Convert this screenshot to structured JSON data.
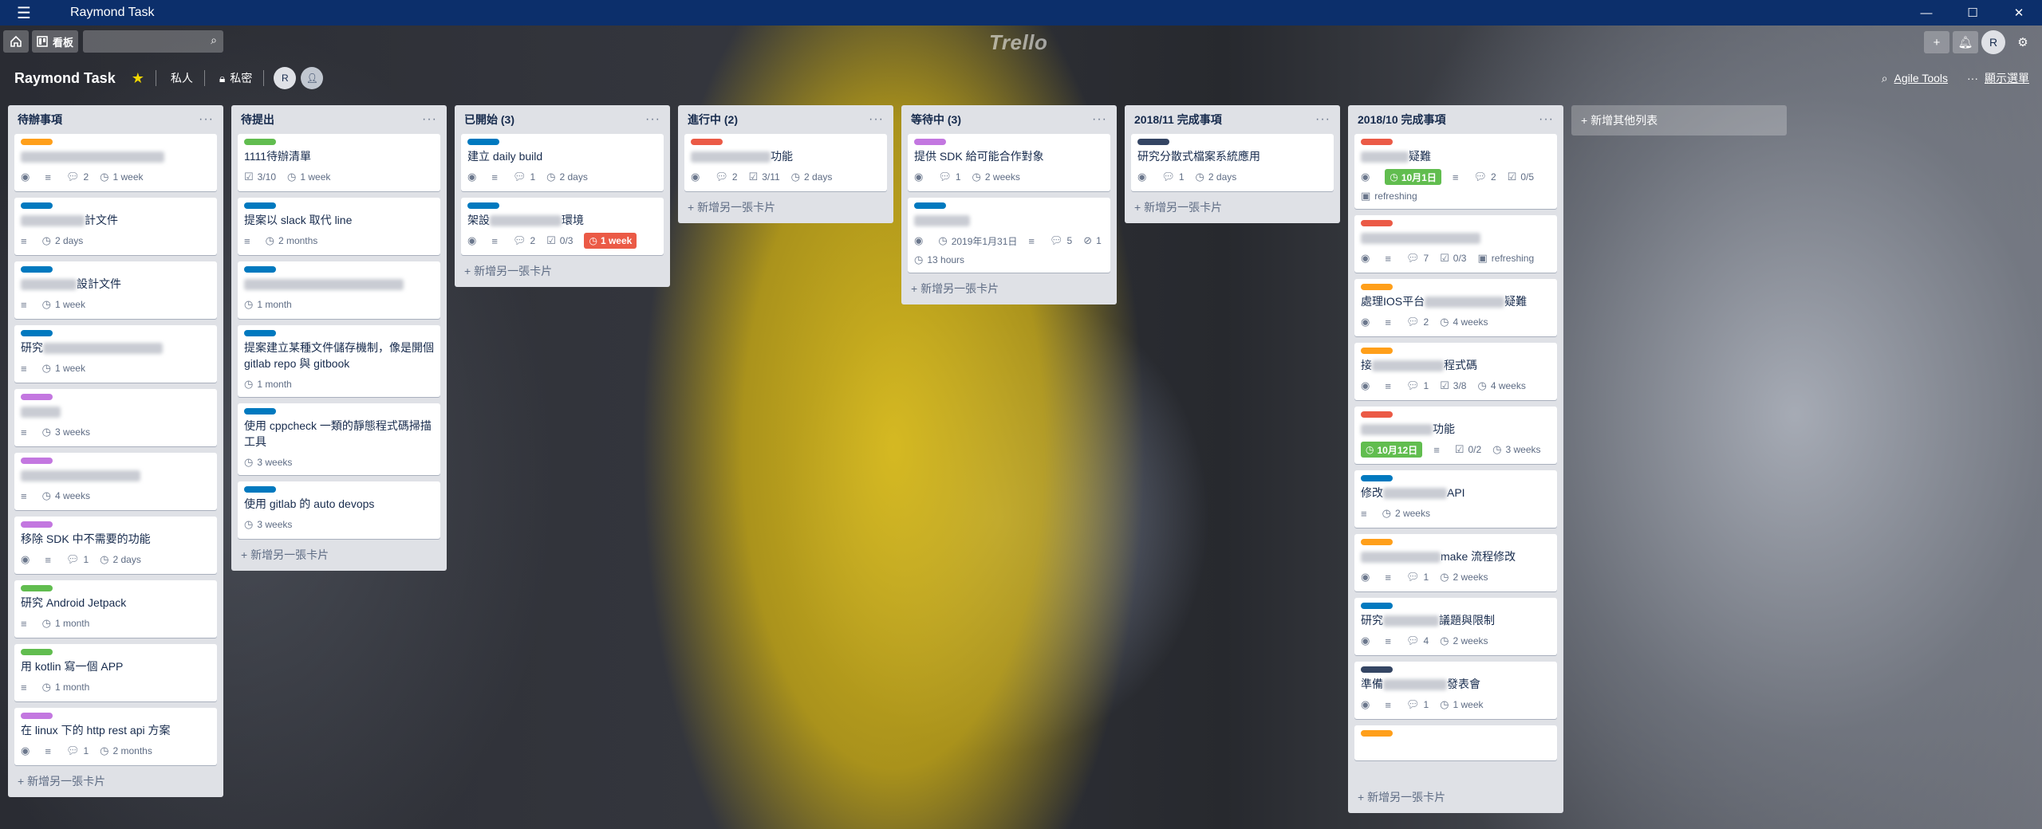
{
  "window": {
    "title": "Raymond Task",
    "controls": [
      "—",
      "☐",
      "✕"
    ]
  },
  "nav": {
    "home_icon": "home-icon",
    "boards_label": "看板",
    "search_placeholder": "",
    "logo": "Trello",
    "user_initial": "R"
  },
  "board": {
    "title": "Raymond Task",
    "visibility_personal": "私人",
    "visibility_private": "私密",
    "member_initial": "R",
    "agile_tools": "Agile Tools",
    "show_menu": "顯示選單",
    "add_list": "+ 新增其他列表"
  },
  "colors": {
    "orange": "#ff9f1a",
    "blue": "#0079bf",
    "green": "#61bd4f",
    "purple": "#c377e0",
    "red": "#eb5a46",
    "black": "#344563"
  },
  "lists": [
    {
      "title": "待辦事項",
      "add": "+ 新增另一張卡片",
      "cards": [
        {
          "label": "orange",
          "pre": "",
          "post": "",
          "blur": 180,
          "badges": [
            [
              "eye",
              ""
            ],
            [
              "desc",
              ""
            ],
            [
              "comment",
              "2"
            ],
            [
              "clock",
              "1 week"
            ]
          ]
        },
        {
          "label": "blue",
          "pre": "",
          "post": "計文件",
          "blur": 80,
          "badges": [
            [
              "desc",
              ""
            ],
            [
              "clock",
              "2 days"
            ]
          ]
        },
        {
          "label": "blue",
          "pre": "",
          "post": "設計文件",
          "blur": 70,
          "badges": [
            [
              "desc",
              ""
            ],
            [
              "clock",
              "1 week"
            ]
          ]
        },
        {
          "label": "blue",
          "pre": "研究",
          "post": "",
          "blur": 150,
          "badges": [
            [
              "desc",
              ""
            ],
            [
              "clock",
              "1 week"
            ]
          ]
        },
        {
          "label": "purple",
          "pre": "",
          "post": "",
          "blur": 50,
          "badges": [
            [
              "desc",
              ""
            ],
            [
              "clock",
              "3 weeks"
            ]
          ]
        },
        {
          "label": "purple",
          "pre": "",
          "post": "",
          "blur": 150,
          "badges": [
            [
              "desc",
              ""
            ],
            [
              "clock",
              "4 weeks"
            ]
          ]
        },
        {
          "label": "purple",
          "pre": "移除 SDK 中不需要的功能",
          "post": "",
          "blur": 0,
          "badges": [
            [
              "eye",
              ""
            ],
            [
              "desc",
              ""
            ],
            [
              "comment",
              "1"
            ],
            [
              "clock",
              "2 days"
            ]
          ]
        },
        {
          "label": "green",
          "pre": "研究 Android Jetpack",
          "post": "",
          "blur": 0,
          "badges": [
            [
              "desc",
              ""
            ],
            [
              "clock",
              "1 month"
            ]
          ]
        },
        {
          "label": "green",
          "pre": "用 kotlin 寫一個 APP",
          "post": "",
          "blur": 0,
          "badges": [
            [
              "desc",
              ""
            ],
            [
              "clock",
              "1 month"
            ]
          ]
        },
        {
          "label": "purple",
          "pre": "在 linux 下的 http rest api 方案",
          "post": "",
          "blur": 0,
          "badges": [
            [
              "eye",
              ""
            ],
            [
              "desc",
              ""
            ],
            [
              "comment",
              "1"
            ],
            [
              "clock",
              "2 months"
            ]
          ]
        }
      ]
    },
    {
      "title": "待提出",
      "add": "+ 新增另一張卡片",
      "cards": [
        {
          "label": "green",
          "pre": "1111待辦清單",
          "post": "",
          "blur": 0,
          "badges": [
            [
              "check",
              "3/10"
            ],
            [
              "clock",
              "1 week"
            ]
          ]
        },
        {
          "label": "blue",
          "pre": "提案以 slack 取代 line",
          "post": "",
          "blur": 0,
          "badges": [
            [
              "desc",
              ""
            ],
            [
              "clock",
              "2 months"
            ]
          ]
        },
        {
          "label": "blue",
          "pre": "",
          "post": "",
          "blur": 200,
          "badges": [
            [
              "clock",
              "1 month"
            ]
          ]
        },
        {
          "label": "blue",
          "pre": "提案建立某種文件儲存機制，像是開個 gitlab repo 與 gitbook",
          "post": "",
          "blur": 0,
          "badges": [
            [
              "clock",
              "1 month"
            ]
          ]
        },
        {
          "label": "blue",
          "pre": "使用 cppcheck 一類的靜態程式碼掃描工具",
          "post": "",
          "blur": 0,
          "badges": [
            [
              "clock",
              "3 weeks"
            ]
          ]
        },
        {
          "label": "blue",
          "pre": "使用 gitlab 的 auto devops",
          "post": "",
          "blur": 0,
          "badges": [
            [
              "clock",
              "3 weeks"
            ]
          ]
        }
      ]
    },
    {
      "title": "已開始 (3)",
      "add": "+ 新增另一張卡片",
      "cards": [
        {
          "label": "blue",
          "pre": "建立 daily build",
          "post": "",
          "blur": 0,
          "badges": [
            [
              "eye",
              ""
            ],
            [
              "desc",
              ""
            ],
            [
              "comment",
              "1"
            ],
            [
              "clock",
              "2 days"
            ]
          ]
        },
        {
          "label": "blue",
          "pre": "架設",
          "post": "環境",
          "blur": 90,
          "badges": [
            [
              "eye",
              ""
            ],
            [
              "desc",
              ""
            ],
            [
              "comment",
              "2"
            ],
            [
              "check",
              "0/3"
            ],
            [
              "due-red",
              "1 week"
            ]
          ]
        }
      ]
    },
    {
      "title": "進行中 (2)",
      "add": "+ 新增另一張卡片",
      "cards": [
        {
          "label": "red",
          "pre": "",
          "post": "功能",
          "blur": 100,
          "badges": [
            [
              "eye",
              ""
            ],
            [
              "comment",
              "2"
            ],
            [
              "check",
              "3/11"
            ],
            [
              "clock",
              "2 days"
            ]
          ]
        }
      ]
    },
    {
      "title": "等待中 (3)",
      "add": "+ 新增另一張卡片",
      "cards": [
        {
          "label": "purple",
          "pre": "提供 SDK 給可能合作對象",
          "post": "",
          "blur": 0,
          "badges": [
            [
              "eye",
              ""
            ],
            [
              "comment",
              "1"
            ],
            [
              "clock",
              "2 weeks"
            ]
          ]
        },
        {
          "label": "blue",
          "pre": "",
          "post": "",
          "blur": 70,
          "badges": [
            [
              "eye",
              ""
            ],
            [
              "clock",
              "2019年1月31日"
            ],
            [
              "desc",
              ""
            ],
            [
              "comment",
              "5"
            ],
            [
              "attach",
              "1"
            ],
            [
              "clock",
              "13 hours"
            ]
          ]
        }
      ]
    },
    {
      "title": "2018/11 完成事項",
      "add": "+ 新增另一張卡片",
      "cards": [
        {
          "label": "black",
          "pre": "研究分散式檔案系統應用",
          "post": "",
          "blur": 0,
          "badges": [
            [
              "eye",
              ""
            ],
            [
              "comment",
              "1"
            ],
            [
              "clock",
              "2 days"
            ]
          ]
        }
      ]
    },
    {
      "title": "2018/10 完成事項",
      "add": "+ 新增另一張卡片",
      "cards": [
        {
          "label": "red",
          "pre": "",
          "post": "疑難",
          "blur": 60,
          "badges": [
            [
              "eye",
              ""
            ],
            [
              "due-green",
              "10月1日"
            ],
            [
              "desc",
              ""
            ],
            [
              "comment",
              "2"
            ],
            [
              "check",
              "0/5"
            ],
            [
              "cal",
              "refreshing"
            ]
          ]
        },
        {
          "label": "red",
          "pre": "",
          "post": "",
          "blur": 150,
          "badges": [
            [
              "eye",
              ""
            ],
            [
              "desc",
              ""
            ],
            [
              "comment",
              "7"
            ],
            [
              "check",
              "0/3"
            ],
            [
              "cal",
              "refreshing"
            ]
          ]
        },
        {
          "label": "orange",
          "pre": "處理IOS平台",
          "post": "疑難",
          "blur": 100,
          "badges": [
            [
              "eye",
              ""
            ],
            [
              "desc",
              ""
            ],
            [
              "comment",
              "2"
            ],
            [
              "clock",
              "4 weeks"
            ]
          ]
        },
        {
          "label": "orange",
          "pre": "接",
          "post": "程式碼",
          "blur": 90,
          "badges": [
            [
              "eye",
              ""
            ],
            [
              "desc",
              ""
            ],
            [
              "comment",
              "1"
            ],
            [
              "check",
              "3/8"
            ],
            [
              "clock",
              "4 weeks"
            ]
          ]
        },
        {
          "label": "red",
          "pre": "",
          "post": "功能",
          "blur": 90,
          "badges": [
            [
              "due-green",
              "10月12日"
            ],
            [
              "desc",
              ""
            ],
            [
              "check",
              "0/2"
            ],
            [
              "clock",
              "3 weeks"
            ]
          ]
        },
        {
          "label": "blue",
          "pre": "修改",
          "post": "API",
          "blur": 80,
          "badges": [
            [
              "desc",
              ""
            ],
            [
              "clock",
              "2 weeks"
            ]
          ]
        },
        {
          "label": "orange",
          "pre": "",
          "post": "make 流程修改",
          "blur": 100,
          "badges": [
            [
              "eye",
              ""
            ],
            [
              "desc",
              ""
            ],
            [
              "comment",
              "1"
            ],
            [
              "clock",
              "2 weeks"
            ]
          ]
        },
        {
          "label": "blue",
          "pre": "研究",
          "post": "議題與限制",
          "blur": 70,
          "badges": [
            [
              "eye",
              ""
            ],
            [
              "desc",
              ""
            ],
            [
              "comment",
              "4"
            ],
            [
              "clock",
              "2 weeks"
            ]
          ]
        },
        {
          "label": "black",
          "pre": "準備",
          "post": "發表會",
          "blur": 80,
          "badges": [
            [
              "eye",
              ""
            ],
            [
              "desc",
              ""
            ],
            [
              "comment",
              "1"
            ],
            [
              "clock",
              "1 week"
            ]
          ]
        },
        {
          "label": "orange",
          "pre": "",
          "post": "",
          "blur": 0,
          "badges": []
        }
      ]
    }
  ]
}
